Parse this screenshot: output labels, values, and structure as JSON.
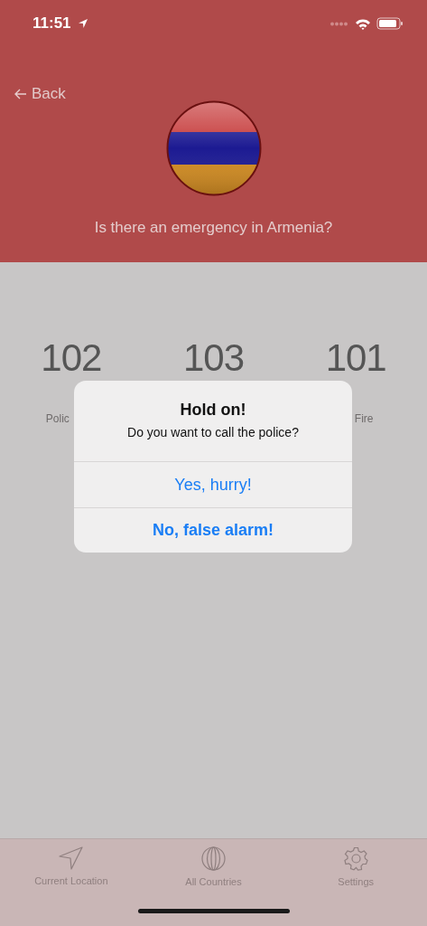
{
  "status_bar": {
    "time": "11:51"
  },
  "header": {
    "back": "Back",
    "question": "Is there an emergency in Armenia?"
  },
  "services": [
    {
      "number": "102",
      "label": "Polic"
    },
    {
      "number": "103"
    },
    {
      "number": "101",
      "label": "Fire"
    }
  ],
  "alert": {
    "title": "Hold on!",
    "message": "Do you want to call the police?",
    "buttons": [
      {
        "label": "Yes, hurry!",
        "kind": "normal"
      },
      {
        "label": "No, false alarm!",
        "kind": "preferred"
      }
    ]
  },
  "tab_bar": [
    {
      "label": "Current Location",
      "kind": "location"
    },
    {
      "label": "All Countries",
      "kind": "globe"
    },
    {
      "label": "Settings",
      "kind": "settings"
    }
  ]
}
